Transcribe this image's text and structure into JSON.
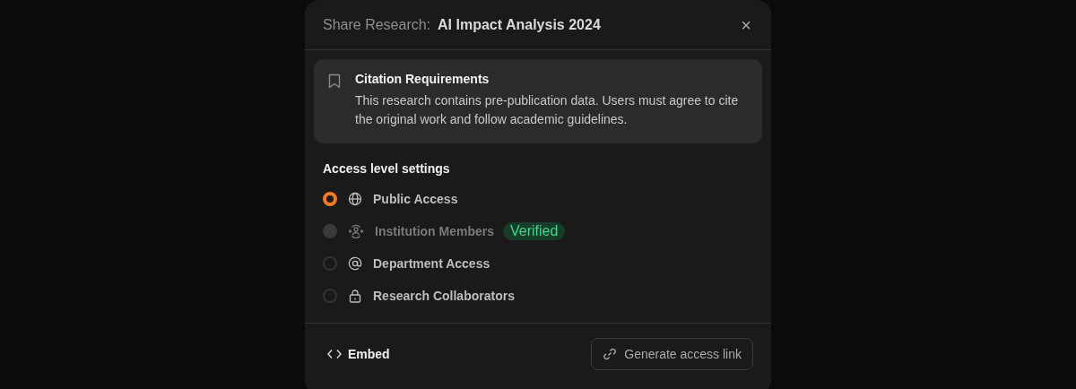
{
  "dialog": {
    "title_label": "Share Research:",
    "title": "AI Impact Analysis 2024",
    "close": "×"
  },
  "notice": {
    "title": "Citation Requirements",
    "text": "This research contains pre-publication data. Users must agree to cite the original work and follow academic guidelines."
  },
  "access": {
    "heading": "Access level settings",
    "options": [
      {
        "label": "Public Access",
        "selected": true,
        "disabled": false
      },
      {
        "label": "Institution Members",
        "selected": false,
        "disabled": true,
        "badge": "Verified"
      },
      {
        "label": "Department Access",
        "selected": false,
        "disabled": false
      },
      {
        "label": "Research Collaborators",
        "selected": false,
        "disabled": false
      }
    ]
  },
  "footer": {
    "embed": "Embed",
    "generate": "Generate access link"
  }
}
